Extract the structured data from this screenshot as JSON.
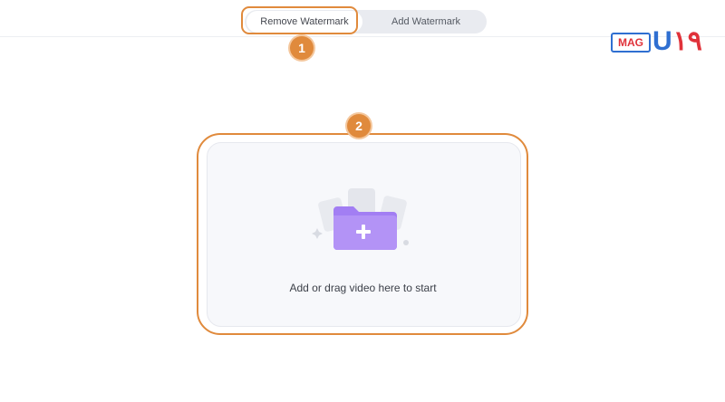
{
  "tabs": {
    "remove_label": "Remove Watermark",
    "add_label": "Add Watermark"
  },
  "steps": [
    "1",
    "2"
  ],
  "brand": {
    "badge": "MAG",
    "logo_main": "U",
    "logo_accent": "۱۹"
  },
  "dropzone": {
    "text": "Add or drag video here to start"
  },
  "colors": {
    "highlight": "#e08a3c",
    "folder": "#a27ef3",
    "brand_blue": "#2f6fd1",
    "brand_red": "#e0323a"
  }
}
